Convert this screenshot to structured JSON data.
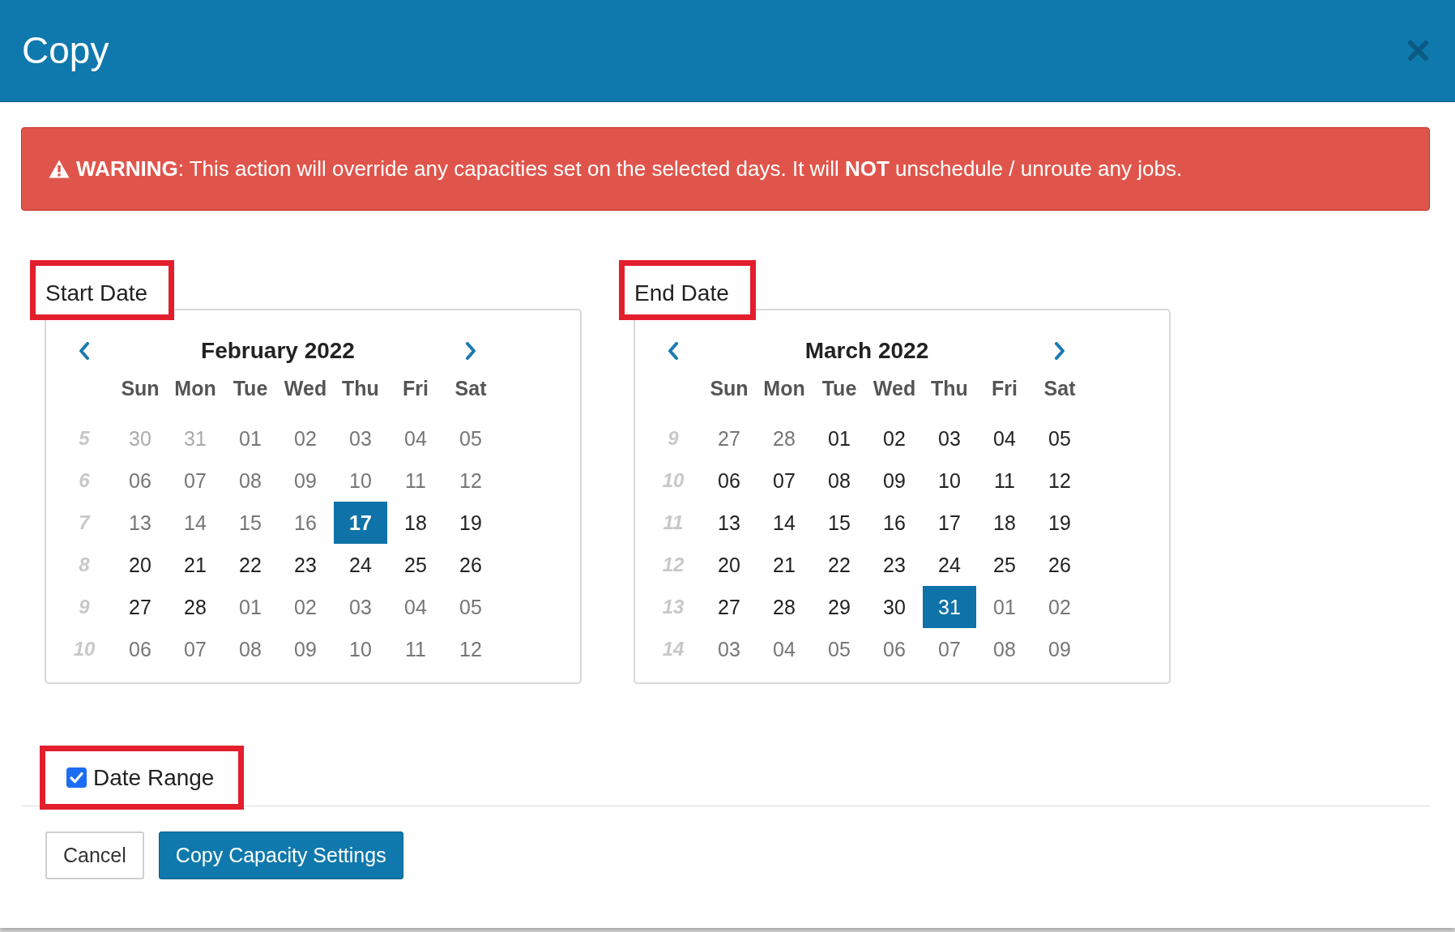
{
  "dialog": {
    "title": "Copy"
  },
  "warning": {
    "message": "**WARNING**: This action will override any capacities set on the selected days. It will **NOT** unschedule / unroute any jobs."
  },
  "calendars": [
    {
      "label": "Start Date",
      "highlighted": true,
      "month": "February 2022",
      "weekdays": [
        "Sun",
        "Mon",
        "Tue",
        "Wed",
        "Thu",
        "Fri",
        "Sat"
      ],
      "weeks": [
        {
          "number": "5",
          "days": [
            {
              "day": "30",
              "selected": false,
              "today": false,
              "outside": true,
              "disabled": true
            },
            {
              "day": "31",
              "selected": false,
              "today": false,
              "outside": true,
              "disabled": true
            },
            {
              "day": "01",
              "selected": false,
              "today": false,
              "outside": false,
              "disabled": true
            },
            {
              "day": "02",
              "selected": false,
              "today": false,
              "outside": false,
              "disabled": true
            },
            {
              "day": "03",
              "selected": false,
              "today": false,
              "outside": false,
              "disabled": true
            },
            {
              "day": "04",
              "selected": false,
              "today": false,
              "outside": false,
              "disabled": true
            },
            {
              "day": "05",
              "selected": false,
              "today": false,
              "outside": false,
              "disabled": true
            }
          ]
        },
        {
          "number": "6",
          "days": [
            {
              "day": "06",
              "selected": false,
              "today": false,
              "outside": false,
              "disabled": true
            },
            {
              "day": "07",
              "selected": false,
              "today": false,
              "outside": false,
              "disabled": true
            },
            {
              "day": "08",
              "selected": false,
              "today": false,
              "outside": false,
              "disabled": true
            },
            {
              "day": "09",
              "selected": false,
              "today": false,
              "outside": false,
              "disabled": true
            },
            {
              "day": "10",
              "selected": false,
              "today": false,
              "outside": false,
              "disabled": true
            },
            {
              "day": "11",
              "selected": false,
              "today": false,
              "outside": false,
              "disabled": true
            },
            {
              "day": "12",
              "selected": false,
              "today": false,
              "outside": false,
              "disabled": true
            }
          ]
        },
        {
          "number": "7",
          "days": [
            {
              "day": "13",
              "selected": false,
              "today": false,
              "outside": false,
              "disabled": true
            },
            {
              "day": "14",
              "selected": false,
              "today": false,
              "outside": false,
              "disabled": true
            },
            {
              "day": "15",
              "selected": false,
              "today": false,
              "outside": false,
              "disabled": true
            },
            {
              "day": "16",
              "selected": false,
              "today": false,
              "outside": false,
              "disabled": true
            },
            {
              "day": "17",
              "selected": true,
              "today": true,
              "outside": false,
              "disabled": false
            },
            {
              "day": "18",
              "selected": false,
              "today": false,
              "outside": false,
              "disabled": false
            },
            {
              "day": "19",
              "selected": false,
              "today": false,
              "outside": false,
              "disabled": false
            }
          ]
        },
        {
          "number": "8",
          "days": [
            {
              "day": "20",
              "selected": false,
              "today": false,
              "outside": false,
              "disabled": false
            },
            {
              "day": "21",
              "selected": false,
              "today": false,
              "outside": false,
              "disabled": false
            },
            {
              "day": "22",
              "selected": false,
              "today": false,
              "outside": false,
              "disabled": false
            },
            {
              "day": "23",
              "selected": false,
              "today": false,
              "outside": false,
              "disabled": false
            },
            {
              "day": "24",
              "selected": false,
              "today": false,
              "outside": false,
              "disabled": false
            },
            {
              "day": "25",
              "selected": false,
              "today": false,
              "outside": false,
              "disabled": false
            },
            {
              "day": "26",
              "selected": false,
              "today": false,
              "outside": false,
              "disabled": false
            }
          ]
        },
        {
          "number": "9",
          "days": [
            {
              "day": "27",
              "selected": false,
              "today": false,
              "outside": false,
              "disabled": false
            },
            {
              "day": "28",
              "selected": false,
              "today": false,
              "outside": false,
              "disabled": false
            },
            {
              "day": "01",
              "selected": false,
              "today": false,
              "outside": true,
              "disabled": false
            },
            {
              "day": "02",
              "selected": false,
              "today": false,
              "outside": true,
              "disabled": false
            },
            {
              "day": "03",
              "selected": false,
              "today": false,
              "outside": true,
              "disabled": false
            },
            {
              "day": "04",
              "selected": false,
              "today": false,
              "outside": true,
              "disabled": false
            },
            {
              "day": "05",
              "selected": false,
              "today": false,
              "outside": true,
              "disabled": false
            }
          ]
        },
        {
          "number": "10",
          "days": [
            {
              "day": "06",
              "selected": false,
              "today": false,
              "outside": true,
              "disabled": false
            },
            {
              "day": "07",
              "selected": false,
              "today": false,
              "outside": true,
              "disabled": false
            },
            {
              "day": "08",
              "selected": false,
              "today": false,
              "outside": true,
              "disabled": false
            },
            {
              "day": "09",
              "selected": false,
              "today": false,
              "outside": true,
              "disabled": false
            },
            {
              "day": "10",
              "selected": false,
              "today": false,
              "outside": true,
              "disabled": false
            },
            {
              "day": "11",
              "selected": false,
              "today": false,
              "outside": true,
              "disabled": false
            },
            {
              "day": "12",
              "selected": false,
              "today": false,
              "outside": true,
              "disabled": false
            }
          ]
        }
      ]
    },
    {
      "label": "End Date",
      "highlighted": true,
      "month": "March 2022",
      "weekdays": [
        "Sun",
        "Mon",
        "Tue",
        "Wed",
        "Thu",
        "Fri",
        "Sat"
      ],
      "weeks": [
        {
          "number": "9",
          "days": [
            {
              "day": "27",
              "selected": false,
              "today": false,
              "outside": true,
              "disabled": false
            },
            {
              "day": "28",
              "selected": false,
              "today": false,
              "outside": true,
              "disabled": false
            },
            {
              "day": "01",
              "selected": false,
              "today": false,
              "outside": false,
              "disabled": false
            },
            {
              "day": "02",
              "selected": false,
              "today": false,
              "outside": false,
              "disabled": false
            },
            {
              "day": "03",
              "selected": false,
              "today": false,
              "outside": false,
              "disabled": false
            },
            {
              "day": "04",
              "selected": false,
              "today": false,
              "outside": false,
              "disabled": false
            },
            {
              "day": "05",
              "selected": false,
              "today": false,
              "outside": false,
              "disabled": false
            }
          ]
        },
        {
          "number": "10",
          "days": [
            {
              "day": "06",
              "selected": false,
              "today": false,
              "outside": false,
              "disabled": false
            },
            {
              "day": "07",
              "selected": false,
              "today": false,
              "outside": false,
              "disabled": false
            },
            {
              "day": "08",
              "selected": false,
              "today": false,
              "outside": false,
              "disabled": false
            },
            {
              "day": "09",
              "selected": false,
              "today": false,
              "outside": false,
              "disabled": false
            },
            {
              "day": "10",
              "selected": false,
              "today": false,
              "outside": false,
              "disabled": false
            },
            {
              "day": "11",
              "selected": false,
              "today": false,
              "outside": false,
              "disabled": false
            },
            {
              "day": "12",
              "selected": false,
              "today": false,
              "outside": false,
              "disabled": false
            }
          ]
        },
        {
          "number": "11",
          "days": [
            {
              "day": "13",
              "selected": false,
              "today": false,
              "outside": false,
              "disabled": false
            },
            {
              "day": "14",
              "selected": false,
              "today": false,
              "outside": false,
              "disabled": false
            },
            {
              "day": "15",
              "selected": false,
              "today": false,
              "outside": false,
              "disabled": false
            },
            {
              "day": "16",
              "selected": false,
              "today": false,
              "outside": false,
              "disabled": false
            },
            {
              "day": "17",
              "selected": false,
              "today": false,
              "outside": false,
              "disabled": false
            },
            {
              "day": "18",
              "selected": false,
              "today": false,
              "outside": false,
              "disabled": false
            },
            {
              "day": "19",
              "selected": false,
              "today": false,
              "outside": false,
              "disabled": false
            }
          ]
        },
        {
          "number": "12",
          "days": [
            {
              "day": "20",
              "selected": false,
              "today": false,
              "outside": false,
              "disabled": false
            },
            {
              "day": "21",
              "selected": false,
              "today": false,
              "outside": false,
              "disabled": false
            },
            {
              "day": "22",
              "selected": false,
              "today": false,
              "outside": false,
              "disabled": false
            },
            {
              "day": "23",
              "selected": false,
              "today": false,
              "outside": false,
              "disabled": false
            },
            {
              "day": "24",
              "selected": false,
              "today": false,
              "outside": false,
              "disabled": false
            },
            {
              "day": "25",
              "selected": false,
              "today": false,
              "outside": false,
              "disabled": false
            },
            {
              "day": "26",
              "selected": false,
              "today": false,
              "outside": false,
              "disabled": false
            }
          ]
        },
        {
          "number": "13",
          "days": [
            {
              "day": "27",
              "selected": false,
              "today": false,
              "outside": false,
              "disabled": false
            },
            {
              "day": "28",
              "selected": false,
              "today": false,
              "outside": false,
              "disabled": false
            },
            {
              "day": "29",
              "selected": false,
              "today": false,
              "outside": false,
              "disabled": false
            },
            {
              "day": "30",
              "selected": false,
              "today": false,
              "outside": false,
              "disabled": false
            },
            {
              "day": "31",
              "selected": true,
              "today": false,
              "outside": false,
              "disabled": false
            },
            {
              "day": "01",
              "selected": false,
              "today": false,
              "outside": true,
              "disabled": false
            },
            {
              "day": "02",
              "selected": false,
              "today": false,
              "outside": true,
              "disabled": false
            }
          ]
        },
        {
          "number": "14",
          "days": [
            {
              "day": "03",
              "selected": false,
              "today": false,
              "outside": true,
              "disabled": false
            },
            {
              "day": "04",
              "selected": false,
              "today": false,
              "outside": true,
              "disabled": false
            },
            {
              "day": "05",
              "selected": false,
              "today": false,
              "outside": true,
              "disabled": false
            },
            {
              "day": "06",
              "selected": false,
              "today": false,
              "outside": true,
              "disabled": false
            },
            {
              "day": "07",
              "selected": false,
              "today": false,
              "outside": true,
              "disabled": false
            },
            {
              "day": "08",
              "selected": false,
              "today": false,
              "outside": true,
              "disabled": false
            },
            {
              "day": "09",
              "selected": false,
              "today": false,
              "outside": true,
              "disabled": false
            }
          ]
        }
      ]
    }
  ],
  "date_range": {
    "label": "Date Range",
    "checked": true,
    "highlighted": true
  },
  "buttons": [
    {
      "label": "Cancel",
      "kind": "secondary"
    },
    {
      "label": "Copy Capacity Settings",
      "kind": "primary"
    }
  ]
}
